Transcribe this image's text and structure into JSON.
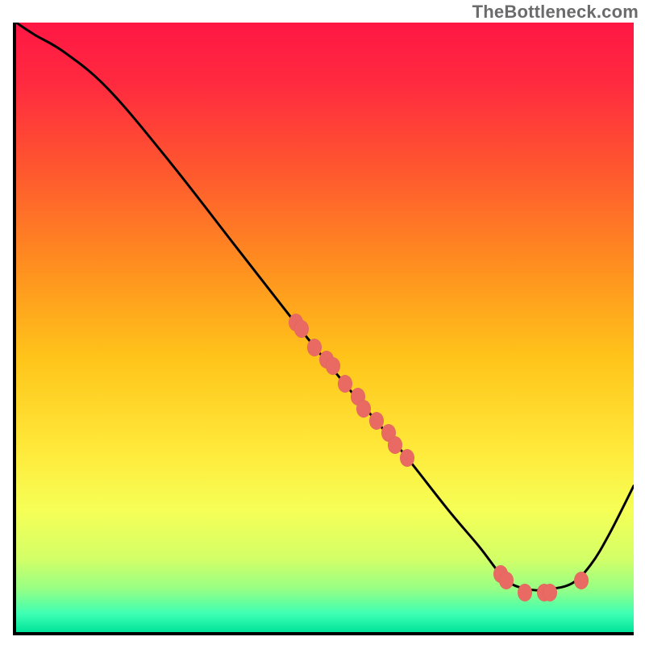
{
  "watermark": "TheBottleneck.com",
  "chart_data": {
    "type": "line",
    "title": "",
    "xlabel": "",
    "ylabel": "",
    "xlim": [
      0,
      100
    ],
    "ylim": [
      0,
      100
    ],
    "grid": false,
    "legend": false,
    "series": [
      {
        "name": "curve",
        "x": [
          0,
          3,
          8,
          15,
          25,
          35,
          45,
          53,
          58,
          63,
          70,
          75,
          78,
          80,
          83,
          86,
          90,
          93,
          96,
          100
        ],
        "y": [
          100,
          98,
          95,
          89,
          77,
          64,
          51,
          41,
          35,
          29,
          20,
          14,
          10,
          8,
          7,
          7,
          8,
          11,
          16,
          24
        ]
      }
    ],
    "markers": [
      {
        "x": 45,
        "y": 51
      },
      {
        "x": 46,
        "y": 50
      },
      {
        "x": 48,
        "y": 47
      },
      {
        "x": 50,
        "y": 45
      },
      {
        "x": 51,
        "y": 44
      },
      {
        "x": 53,
        "y": 41
      },
      {
        "x": 55,
        "y": 39
      },
      {
        "x": 56,
        "y": 37
      },
      {
        "x": 58,
        "y": 35
      },
      {
        "x": 60,
        "y": 33
      },
      {
        "x": 61,
        "y": 31
      },
      {
        "x": 63,
        "y": 29
      },
      {
        "x": 78,
        "y": 10
      },
      {
        "x": 79,
        "y": 9
      },
      {
        "x": 82,
        "y": 7
      },
      {
        "x": 85,
        "y": 7
      },
      {
        "x": 86,
        "y": 7
      },
      {
        "x": 91,
        "y": 9
      }
    ],
    "gradient_stops": [
      {
        "offset": 0.0,
        "color": "#ff1744"
      },
      {
        "offset": 0.1,
        "color": "#ff2a3f"
      },
      {
        "offset": 0.25,
        "color": "#ff5a2e"
      },
      {
        "offset": 0.4,
        "color": "#ff8f1f"
      },
      {
        "offset": 0.55,
        "color": "#ffc41a"
      },
      {
        "offset": 0.7,
        "color": "#ffe93a"
      },
      {
        "offset": 0.8,
        "color": "#f6ff56"
      },
      {
        "offset": 0.88,
        "color": "#d3ff67"
      },
      {
        "offset": 0.93,
        "color": "#95ff85"
      },
      {
        "offset": 0.97,
        "color": "#3dffb4"
      },
      {
        "offset": 1.0,
        "color": "#00e49a"
      }
    ]
  }
}
